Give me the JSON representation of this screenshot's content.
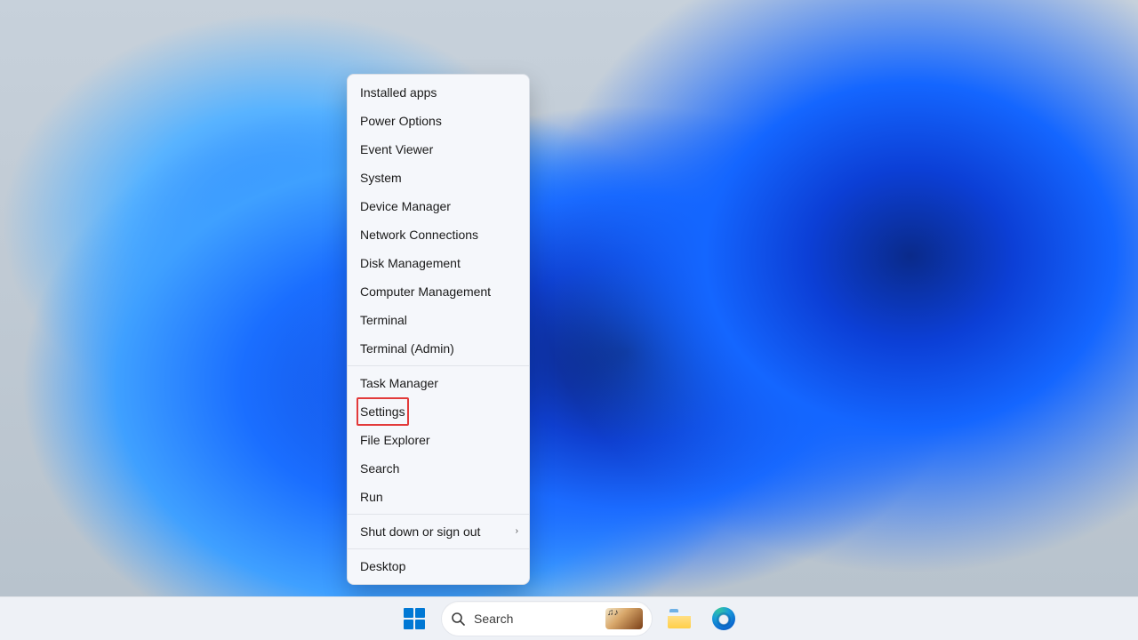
{
  "winx_menu": {
    "groups": [
      [
        {
          "label": "Installed apps",
          "submenu": false
        },
        {
          "label": "Power Options",
          "submenu": false
        },
        {
          "label": "Event Viewer",
          "submenu": false
        },
        {
          "label": "System",
          "submenu": false
        },
        {
          "label": "Device Manager",
          "submenu": false
        },
        {
          "label": "Network Connections",
          "submenu": false
        },
        {
          "label": "Disk Management",
          "submenu": false
        },
        {
          "label": "Computer Management",
          "submenu": false
        },
        {
          "label": "Terminal",
          "submenu": false
        },
        {
          "label": "Terminal (Admin)",
          "submenu": false
        }
      ],
      [
        {
          "label": "Task Manager",
          "submenu": false
        },
        {
          "label": "Settings",
          "submenu": false,
          "highlighted": true
        },
        {
          "label": "File Explorer",
          "submenu": false
        },
        {
          "label": "Search",
          "submenu": false
        },
        {
          "label": "Run",
          "submenu": false
        }
      ],
      [
        {
          "label": "Shut down or sign out",
          "submenu": true
        }
      ],
      [
        {
          "label": "Desktop",
          "submenu": false
        }
      ]
    ]
  },
  "taskbar": {
    "search_placeholder": "Search",
    "search_thumb_glyph": "♫♪",
    "items": [
      {
        "id": "start",
        "name": "Start"
      },
      {
        "id": "search",
        "name": "Search"
      },
      {
        "id": "explorer",
        "name": "File Explorer"
      },
      {
        "id": "edge",
        "name": "Microsoft Edge"
      }
    ]
  },
  "chevron_glyph": "›"
}
